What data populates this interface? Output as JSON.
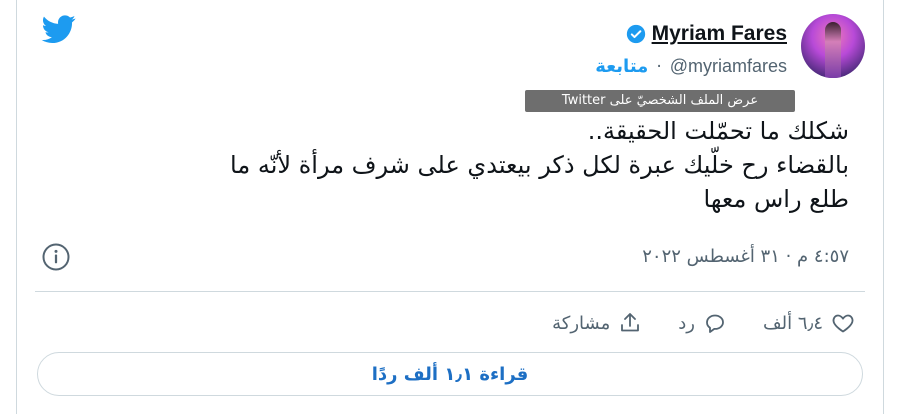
{
  "author": {
    "name": "Myriam Fares",
    "handle": "@myriamfares",
    "follow_label": "متابعة",
    "separator": "·"
  },
  "tooltip": "عرض الملف الشخصيّ على Twitter",
  "tweet": {
    "lines": [
      "شكلك ما تحمّلت الحقيقة..",
      "بالقضاء رح خلّيك عبرة لكل ذكر بيعتدي على شرف مرأة لأنّه ما",
      "طلع راس معها"
    ],
    "timestamp": "٤:٥٧ م · ٣١ أغسطس ٢٠٢٢"
  },
  "actions": {
    "like_count": "٦٫٤ ألف",
    "reply_label": "رد",
    "share_label": "مشاركة"
  },
  "read_replies_label": "قراءة ١٫١ ألف ردًا",
  "colors": {
    "accent": "#1d9bf0",
    "muted": "#536471",
    "border": "#cfd9de"
  },
  "icons": [
    "twitter-bird-icon",
    "verified-badge-icon",
    "info-icon",
    "heart-icon",
    "reply-icon",
    "share-icon"
  ]
}
